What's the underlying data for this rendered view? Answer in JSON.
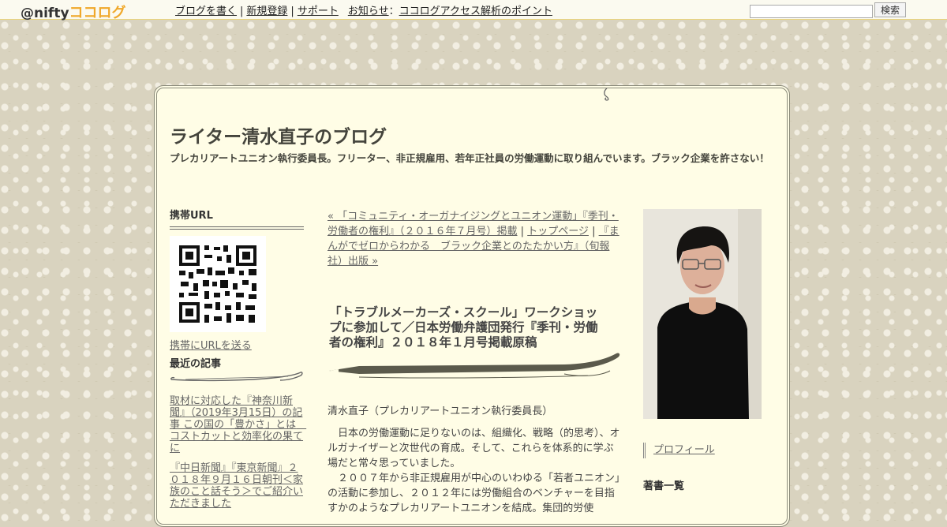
{
  "topbar": {
    "logo_prefix": "@nifty",
    "logo_brand": "ココログ",
    "links": [
      "ブログを書く",
      "新規登録",
      "サポート"
    ],
    "news_label": "お知らせ",
    "news_colon": "：",
    "news_link": "ココログアクセス解析のポイント",
    "search_value": "",
    "search_button": "検索"
  },
  "blog": {
    "title": "ライター清水直子のブログ",
    "description": "プレカリアートユニオン執行委員長。フリーター、非正規雇用、若年正社員の労働運動に取り組んでいます。ブラック企業を許さない！"
  },
  "sidebar": {
    "mobile_heading": "携帯URL",
    "mobile_link": "携帯にURLを送る",
    "recent_heading": "最近の記事",
    "recent_items": [
      "取材に対応した『神奈川新聞』（2019年3月15日）の記事 この国の「豊かさ」とは　コストカットと効率化の果てに",
      "『中日新聞』『東京新聞』２０１８年９月１６日朝刊＜家族のこと話そう＞でご紹介いただきました"
    ]
  },
  "post": {
    "prev_link": "« 「コミュニティ・オーガナイジングとユニオン運動」『季刊・労働者の権利』（２０１６年７月号）掲載",
    "separator": "|",
    "top_link": "トップページ",
    "next_link": "『まんがでゼロからわかる　ブラック企業とのたたかい方』（旬報社）出版 »",
    "title": "「トラブルメーカーズ・スクール」ワークショップに参加して／日本労働弁護団発行『季刊・労働者の権利』２０１８年１月号掲載原稿",
    "author_line": "清水直子（プレカリアートユニオン執行委員長）",
    "paragraph_1": "　日本の労働運動に足りないのは、組織化、戦略（的思考）、オルガナイザーと次世代の育成。そして、これらを体系的に学ぶ場だと常々思っていました。",
    "paragraph_2": "　２００７年から非正規雇用が中心のいわゆる「若者ユニオン」の活動に参加し、２０１２年には労働組合のベンチャーを目指すかのようなプレカリアートユニオンを結成。集団的労使"
  },
  "right": {
    "profile_link": "プロフィール",
    "books_heading": "著書一覧"
  },
  "icons": {
    "pen": "fountain-pen-divider-icon",
    "swash": "decorative-swash-icon",
    "hook": "hanger-hook-icon"
  },
  "colors": {
    "brand_orange": "#f0a82a",
    "frame_bg": "#fffde6",
    "link_gray": "#666666"
  }
}
